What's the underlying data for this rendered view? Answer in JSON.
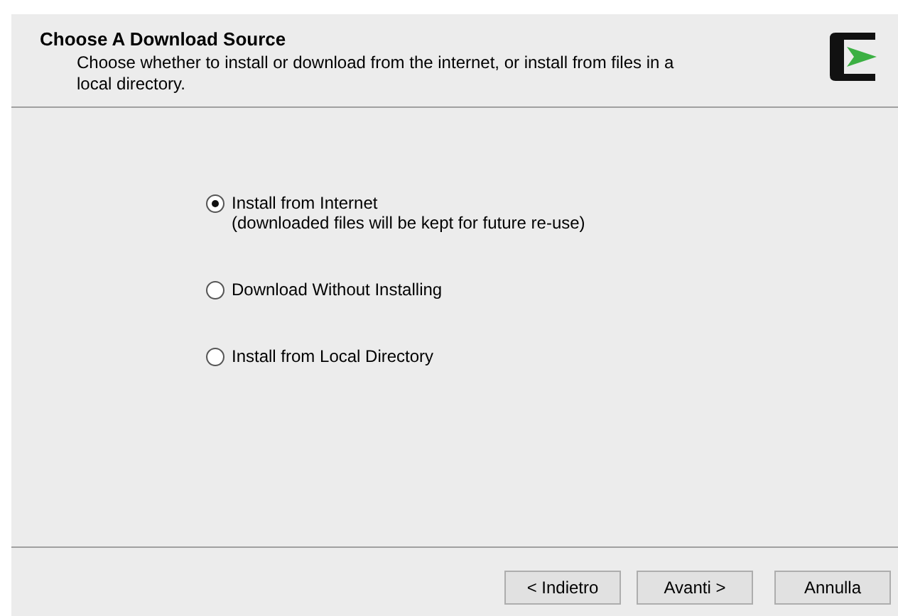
{
  "header": {
    "title": "Choose A Download Source",
    "description": "Choose whether to install or download from the internet, or install from files in a local directory."
  },
  "options": [
    {
      "label": "Install from Internet",
      "note": "(downloaded files will be kept for future re-use)",
      "selected": true
    },
    {
      "label": "Download Without Installing",
      "selected": false
    },
    {
      "label": "Install from Local Directory",
      "selected": false
    }
  ],
  "buttons": [
    "< Indietro",
    "Avanti >",
    "Annulla"
  ]
}
